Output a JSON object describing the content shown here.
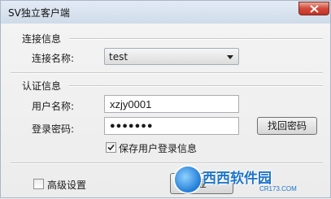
{
  "window": {
    "title": "SV独立客户端"
  },
  "connection": {
    "section_title": "连接信息",
    "name_label": "连接名称:",
    "name_value": "test"
  },
  "auth": {
    "section_title": "认证信息",
    "username_label": "用户名称:",
    "username_value": "xzjy0001",
    "password_label": "登录密码:",
    "password_mask": "●●●●●●●",
    "recover_button": "找回密码",
    "save_checkbox_label": "保存用户登录信息",
    "save_checked": true
  },
  "advanced": {
    "label": "高级设置",
    "checked": false
  },
  "login_button_partial": "登",
  "watermark": {
    "text": "西西软件园",
    "sub": "CR173.COM"
  },
  "colors": {
    "title_bar": "#cfdbe9",
    "close": "#c23425",
    "watermark": "#1e74c8"
  }
}
